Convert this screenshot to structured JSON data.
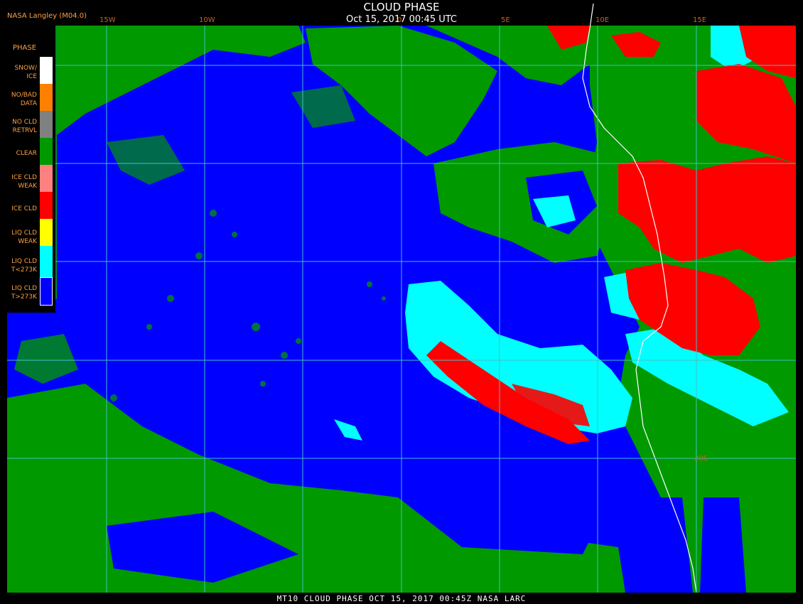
{
  "header": {
    "title": "CLOUD PHASE",
    "datetime": "Oct 15, 2017 00:45 UTC",
    "credit": "NASA Langley (M04.0)"
  },
  "footer": {
    "text": "MT10  CLOUD PHASE   OCT 15, 2017 00:45Z   NASA LARC"
  },
  "legend": {
    "title": "PHASE",
    "items": [
      {
        "label1": "SNOW/",
        "label2": "ICE",
        "color": "#ffffff"
      },
      {
        "label1": "NO/BAD",
        "label2": "DATA",
        "color": "#ff8000"
      },
      {
        "label1": "NO CLD",
        "label2": "RETRVL",
        "color": "#808080"
      },
      {
        "label1": "CLEAR",
        "label2": "",
        "color": "#009900"
      },
      {
        "label1": "ICE CLD",
        "label2": "WEAK",
        "color": "#ff8080"
      },
      {
        "label1": "ICE CLD",
        "label2": "",
        "color": "#ff0000"
      },
      {
        "label1": "LIQ CLD",
        "label2": "WEAK",
        "color": "#ffff00"
      },
      {
        "label1": "LIQ CLD",
        "label2": "T<273K",
        "color": "#00ffff"
      },
      {
        "label1": "LIQ CLD",
        "label2": "T>273K",
        "color": "#0000ff"
      }
    ]
  },
  "grid": {
    "lon_labels": [
      "15W",
      "10W",
      "0",
      "5E",
      "10E",
      "15E"
    ],
    "lat_labels": [
      "20S"
    ],
    "line_color": "#40c0c0"
  },
  "colors": {
    "ocean_liquid": "#0000ff",
    "clear": "#009900",
    "ice": "#ff0000",
    "liquid_cold": "#00ffff",
    "coast": "#ffffff"
  }
}
